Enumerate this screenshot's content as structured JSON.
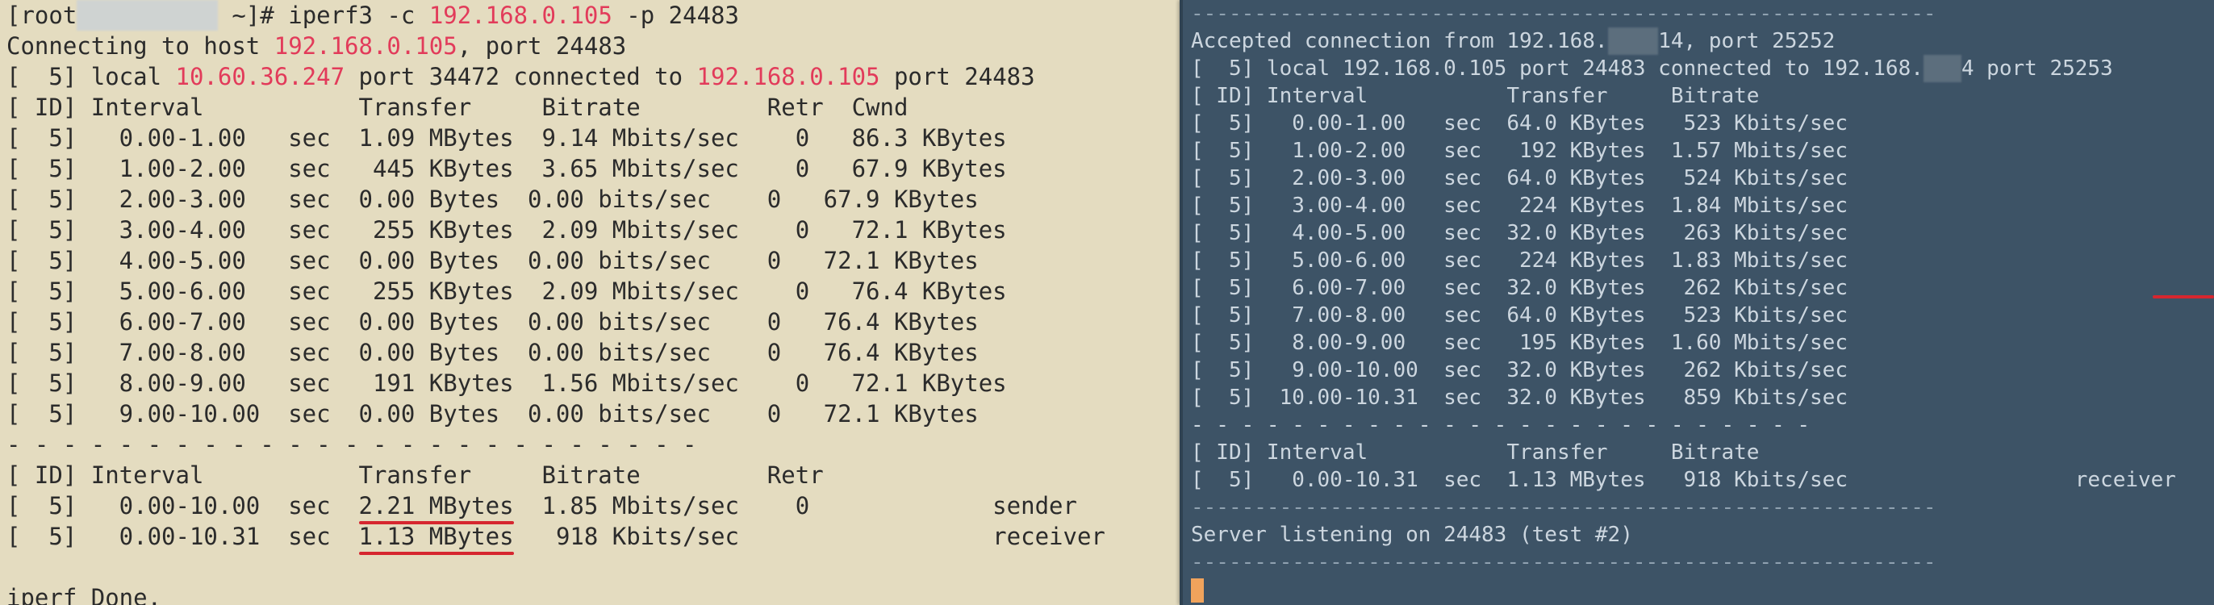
{
  "client": {
    "prompt": {
      "prefix": "[root",
      "host_masked": "@xxxxxxxxx",
      "path": " ~]# ",
      "cmd": "iperf3 -c ",
      "ip": "192.168.0.105",
      "port_flag": " -p 24483"
    },
    "connecting": {
      "pre": "Connecting to host ",
      "ip": "192.168.0.105",
      "post": ", port 24483"
    },
    "local": {
      "pre": "[  5] local ",
      "ip1": "10.60.36.247",
      "mid": " port 34472 connected to ",
      "ip2": "192.168.0.105",
      "post": " port 24483"
    },
    "header": "[ ID] Interval           Transfer     Bitrate         Retr  Cwnd",
    "rows": [
      "[  5]   0.00-1.00   sec  1.09 MBytes  9.14 Mbits/sec    0   86.3 KBytes",
      "[  5]   1.00-2.00   sec   445 KBytes  3.65 Mbits/sec    0   67.9 KBytes",
      "[  5]   2.00-3.00   sec  0.00 Bytes  0.00 bits/sec    0   67.9 KBytes",
      "[  5]   3.00-4.00   sec   255 KBytes  2.09 Mbits/sec    0   72.1 KBytes",
      "[  5]   4.00-5.00   sec  0.00 Bytes  0.00 bits/sec    0   72.1 KBytes",
      "[  5]   5.00-6.00   sec   255 KBytes  2.09 Mbits/sec    0   76.4 KBytes",
      "[  5]   6.00-7.00   sec  0.00 Bytes  0.00 bits/sec    0   76.4 KBytes",
      "[  5]   7.00-8.00   sec  0.00 Bytes  0.00 bits/sec    0   76.4 KBytes",
      "[  5]   8.00-9.00   sec   191 KBytes  1.56 Mbits/sec    0   72.1 KBytes",
      "[  5]   9.00-10.00  sec  0.00 Bytes  0.00 bits/sec    0   72.1 KBytes"
    ],
    "separator": "- - - - - - - - - - - - - - - - - - - - - - - - -",
    "summary_header": "[ ID] Interval           Transfer     Bitrate         Retr",
    "summary": [
      {
        "pre": "[  5]   0.00-10.00  sec  ",
        "transfer": "2.21 MBytes",
        "post": "  1.85 Mbits/sec    0             sender"
      },
      {
        "pre": "[  5]   0.00-10.31  sec  ",
        "transfer": "1.13 MBytes",
        "post": "   918 Kbits/sec                  receiver"
      }
    ],
    "done": "iperf Done."
  },
  "server": {
    "top_rule": "-----------------------------------------------------------",
    "accepted": {
      "pre": "Accepted connection from 192.168.",
      "masked": "xxx.",
      "post": "14, port 25252"
    },
    "local": {
      "pre": "[  5] local 192.168.0.105 port 24483 connected to 192.168.",
      "masked": "xx.",
      "post": "4 port 25253"
    },
    "header": "[ ID] Interval           Transfer     Bitrate",
    "rows": [
      "[  5]   0.00-1.00   sec  64.0 KBytes   523 Kbits/sec",
      "[  5]   1.00-2.00   sec   192 KBytes  1.57 Mbits/sec",
      "[  5]   2.00-3.00   sec  64.0 KBytes   524 Kbits/sec",
      "[  5]   3.00-4.00   sec   224 KBytes  1.84 Mbits/sec",
      "[  5]   4.00-5.00   sec  32.0 KBytes   263 Kbits/sec",
      "[  5]   5.00-6.00   sec   224 KBytes  1.83 Mbits/sec",
      "[  5]   6.00-7.00   sec  32.0 KBytes   262 Kbits/sec",
      "[  5]   7.00-8.00   sec  64.0 KBytes   523 Kbits/sec",
      "[  5]   8.00-9.00   sec   195 KBytes  1.60 Mbits/sec",
      "[  5]   9.00-10.00  sec  32.0 KBytes   262 Kbits/sec",
      "[  5]  10.00-10.31  sec  32.0 KBytes   859 Kbits/sec"
    ],
    "separator": "- - - - - - - - - - - - - - - - - - - - - - - - -",
    "summary_header": "[ ID] Interval           Transfer     Bitrate",
    "summary_row": "[  5]   0.00-10.31  sec  1.13 MBytes   918 Kbits/sec                  receiver",
    "mid_rule": "-----------------------------------------------------------",
    "listening": "Server listening on 24483 (test #2)",
    "bottom_rule": "-----------------------------------------------------------"
  },
  "colors": {
    "highlight_ip": "#e23b5a",
    "underline": "#d6262f",
    "left_bg": "#e4dcc0",
    "right_bg": "#3d5366",
    "cursor": "#f0a35c"
  }
}
